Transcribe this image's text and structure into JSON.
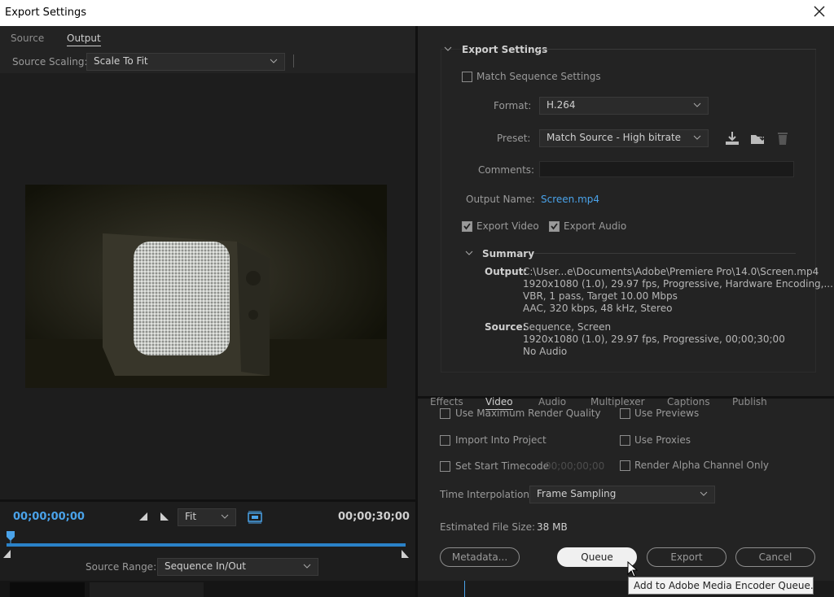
{
  "window": {
    "title": "Export Settings"
  },
  "left_tabs": [
    "Source",
    "Output"
  ],
  "source_scaling": {
    "label": "Source Scaling:",
    "value": "Scale To Fit"
  },
  "export_settings": {
    "header": "Export Settings",
    "match_sequence": "Match Sequence Settings",
    "format_label": "Format:",
    "format_value": "H.264",
    "preset_label": "Preset:",
    "preset_value": "Match Source - High bitrate",
    "comments_label": "Comments:",
    "comments_value": "",
    "output_name_label": "Output Name:",
    "output_name_value": "Screen.mp4",
    "export_video": "Export Video",
    "export_audio": "Export Audio"
  },
  "summary": {
    "header": "Summary",
    "output_label": "Output:",
    "output_lines": [
      "C:\\User...e\\Documents\\Adobe\\Premiere Pro\\14.0\\Screen.mp4",
      "1920x1080 (1.0), 29.97 fps, Progressive, Hardware Encoding,...",
      "VBR, 1 pass, Target 10.00 Mbps",
      "AAC, 320 kbps, 48 kHz, Stereo"
    ],
    "source_label": "Source:",
    "source_lines": [
      "Sequence, Screen",
      "1920x1080 (1.0), 29.97 fps, Progressive, 00;00;30;00",
      "No Audio"
    ]
  },
  "right_tabs": [
    "Effects",
    "Video",
    "Audio",
    "Multiplexer",
    "Captions",
    "Publish"
  ],
  "options": {
    "max_render": "Use Maximum Render Quality",
    "use_previews": "Use Previews",
    "import_project": "Import Into Project",
    "use_proxies": "Use Proxies",
    "set_start_tc": "Set Start Timecode",
    "start_tc_value": "00;00;00;00",
    "alpha_only": "Render Alpha Channel Only",
    "time_interp_label": "Time Interpolation:",
    "time_interp_value": "Frame Sampling",
    "est_size_label": "Estimated File Size:",
    "est_size_value": "38 MB"
  },
  "buttons": {
    "metadata": "Metadata...",
    "queue": "Queue",
    "export": "Export",
    "cancel": "Cancel"
  },
  "tooltip": "Add to Adobe Media Encoder Queue.",
  "timeline": {
    "current_tc": "00;00;00;00",
    "end_tc": "00;00;30;00",
    "fit_value": "Fit",
    "source_range_label": "Source Range:",
    "source_range_value": "Sequence In/Out"
  },
  "colors": {
    "accent": "#4aa3ea",
    "bg": "#232323"
  }
}
